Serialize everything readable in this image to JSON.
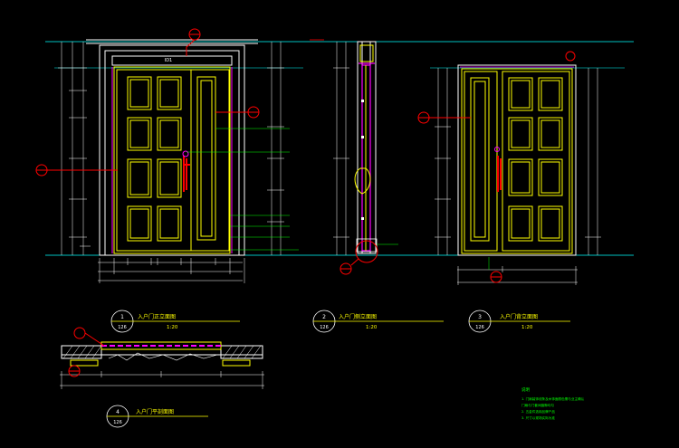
{
  "colors": {
    "background": "#000000",
    "outline": "#ffffff",
    "panel": "#ffff00",
    "frame": "#ff00ff",
    "guide": "#00ffff",
    "text": "#00ff00",
    "marker": "#ff0000",
    "note": "#00ff00"
  },
  "views": [
    {
      "num": "1",
      "sheet": "126",
      "title": "入户门正立面图",
      "scale": "1:20"
    },
    {
      "num": "2",
      "sheet": "126",
      "title": "入户门侧立面图",
      "scale": "1:20"
    },
    {
      "num": "3",
      "sheet": "126",
      "title": "入户门背立面图",
      "scale": "1:20"
    },
    {
      "num": "4",
      "sheet": "126",
      "title": "入户门平剖面图",
      "scale": ""
    }
  ],
  "marks": {
    "door_code": "ID1",
    "detail_ref": "1",
    "detail_sheet": "126"
  },
  "notes": {
    "heading": "说明",
    "lines": [
      "1. 门扇装饰线条及木饰面颜色需与业主确认",
      "   门扇与门套间缝隙均匀",
      "2. 五金件选用品牌产品",
      "3. 尺寸以现场实际为准"
    ]
  }
}
